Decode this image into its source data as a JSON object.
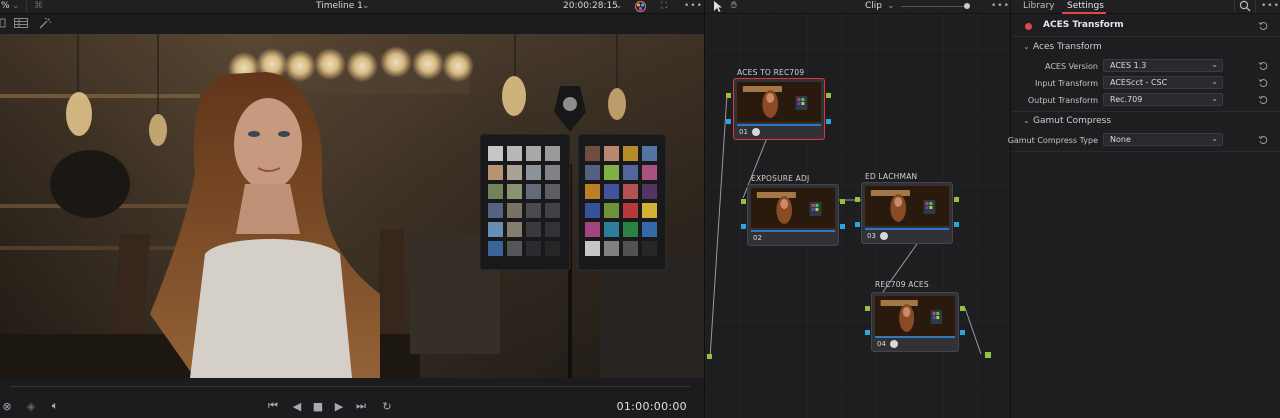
{
  "viewer": {
    "zoom_suffix": "%",
    "timeline_name": "Timeline 1",
    "timecode_top": "20:00:28:15",
    "timecode_bottom": "01:00:00:00"
  },
  "node_editor": {
    "mode_label": "Clip",
    "nodes": [
      {
        "label": "ACES TO REC709",
        "number": "01"
      },
      {
        "label": "EXPOSURE ADJ",
        "number": "02"
      },
      {
        "label": "ED LACHMAN",
        "number": "03"
      },
      {
        "label": "REC709 ACES",
        "number": "04"
      }
    ]
  },
  "settings": {
    "tabs": {
      "library": "Library",
      "settings": "Settings"
    },
    "effect_title": "ACES Transform",
    "sections": {
      "aces": {
        "title": "Aces Transform",
        "rows": [
          {
            "label": "ACES Version",
            "value": "ACES 1.3"
          },
          {
            "label": "Input Transform",
            "value": "ACEScct - CSC"
          },
          {
            "label": "Output Transform",
            "value": "Rec.709"
          }
        ]
      },
      "gamut": {
        "title": "Gamut Compress",
        "rows": [
          {
            "label": "Gamut Compress Type",
            "value": "None"
          }
        ]
      }
    }
  },
  "colors": {
    "accent_red": "#e04848",
    "port_green": "#93c33a",
    "port_blue": "#27a8e0",
    "selection_red": "#d83a3a"
  }
}
